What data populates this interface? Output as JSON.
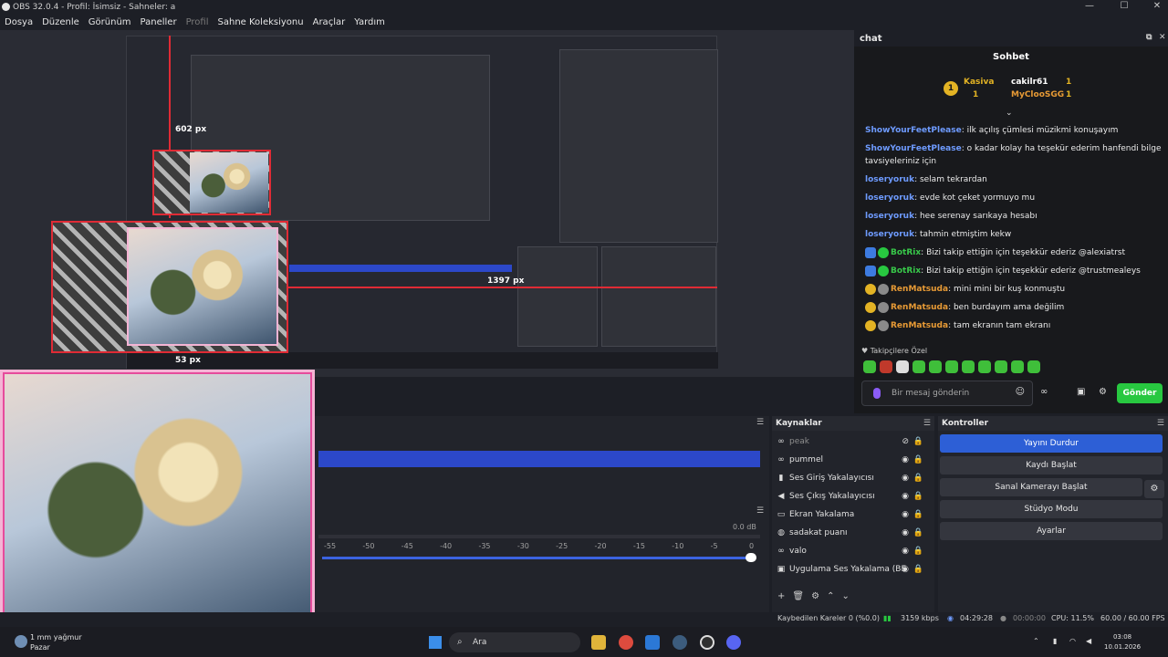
{
  "window": {
    "title": "OBS 32.0.4 - Profil: İsimsiz - Sahneler: a"
  },
  "menu": [
    "Dosya",
    "Düzenle",
    "Görünüm",
    "Paneller",
    "Profil",
    "Sahne Koleksiyonu",
    "Araçlar",
    "Yardım"
  ],
  "preview": {
    "size_label_top": "602 px",
    "size_label_right": "1397 px",
    "size_label_bottom": "53 px"
  },
  "chat": {
    "dock_title": "chat",
    "title": "Sohbet",
    "leaderboard": [
      {
        "name": "Kasiva",
        "count": "1"
      },
      {
        "name": "cakilr61",
        "count": "1"
      },
      {
        "name": "MyClooSGG",
        "count": "1"
      }
    ],
    "messages": [
      {
        "user": "ShowYourFeetPlease",
        "text": ": ilk açılış çümlesi müzikmi konuşayım",
        "color": "#6e9bff"
      },
      {
        "user": "ShowYourFeetPlease",
        "text": ": o kadar kolay ha teşekür ederim hanfendi bilge tavsiyeleriniz için",
        "color": "#6e9bff"
      },
      {
        "user": "loseryoruk",
        "text": ": selam tekrardan",
        "color": "#6e9bff"
      },
      {
        "user": "loseryoruk",
        "text": ": evde kot çeket yormuyo mu",
        "color": "#6e9bff"
      },
      {
        "user": "loseryoruk",
        "text": ": hee serenay sarıkaya hesabı",
        "color": "#6e9bff"
      },
      {
        "user": "loseryoruk",
        "text": ": tahmin etmiştim kekw",
        "color": "#6e9bff"
      },
      {
        "user": "BotRix",
        "text": ": Bizi takip ettiğin için teşekkür ederiz @alexiatrst",
        "color": "#38c94a"
      },
      {
        "user": "BotRix",
        "text": ": Bizi takip ettiğin için teşekkür ederiz @trustmealeys",
        "color": "#38c94a"
      },
      {
        "user": "RenMatsuda",
        "text": ": mini mini bir kuş konmuştu",
        "color": "#e79a35"
      },
      {
        "user": "RenMatsuda",
        "text": ": ben burdayım ama değilim",
        "color": "#e79a35"
      },
      {
        "user": "RenMatsuda",
        "text": ": tam ekranın tam ekranı",
        "color": "#e79a35"
      }
    ],
    "followers_only": "Takipçilere Özel",
    "input_placeholder": "Bir mesaj gönderin",
    "send_label": "Gönder"
  },
  "mixer": {
    "db_label": "0.0 dB",
    "scale": [
      "-55",
      "-50",
      "-45",
      "-40",
      "-35",
      "-30",
      "-25",
      "-20",
      "-15",
      "-10",
      "-5",
      "0"
    ]
  },
  "sources": {
    "title": "Kaynaklar",
    "items": [
      {
        "label": "peak",
        "icon": "link-icon",
        "hidden": true
      },
      {
        "label": "pummel",
        "icon": "link-icon",
        "hidden": false
      },
      {
        "label": "Ses Giriş Yakalayıcısı",
        "icon": "microphone-icon",
        "hidden": false
      },
      {
        "label": "Ses Çıkış Yakalayıcısı",
        "icon": "speaker-icon",
        "hidden": false
      },
      {
        "label": "Ekran Yakalama",
        "icon": "monitor-icon",
        "hidden": false
      },
      {
        "label": "sadakat puanı",
        "icon": "browser-icon",
        "hidden": false
      },
      {
        "label": "valo",
        "icon": "link-icon",
        "hidden": false
      },
      {
        "label": "Uygulama Ses Yakalama (BE",
        "icon": "app-icon",
        "hidden": false
      }
    ]
  },
  "controls": {
    "title": "Kontroller",
    "buttons": [
      "Yayını Durdur",
      "Kaydı Başlat",
      "Sanal Kamerayı Başlat",
      "Stüdyo Modu",
      "Ayarlar"
    ]
  },
  "status": {
    "dropped_frames": "Kaybedilen Kareler 0 (%0.0)",
    "bitrate": "3159 kbps",
    "stream_time": "04:29:28",
    "record_time": "00:00:00",
    "cpu": "CPU: 11.5%",
    "fps": "60.00 / 60.00 FPS"
  },
  "taskbar": {
    "weather_temp": "1 mm yağmur",
    "weather_day": "Pazar",
    "search_placeholder": "Ara",
    "time": "03:08",
    "date": "10.01.2026"
  }
}
